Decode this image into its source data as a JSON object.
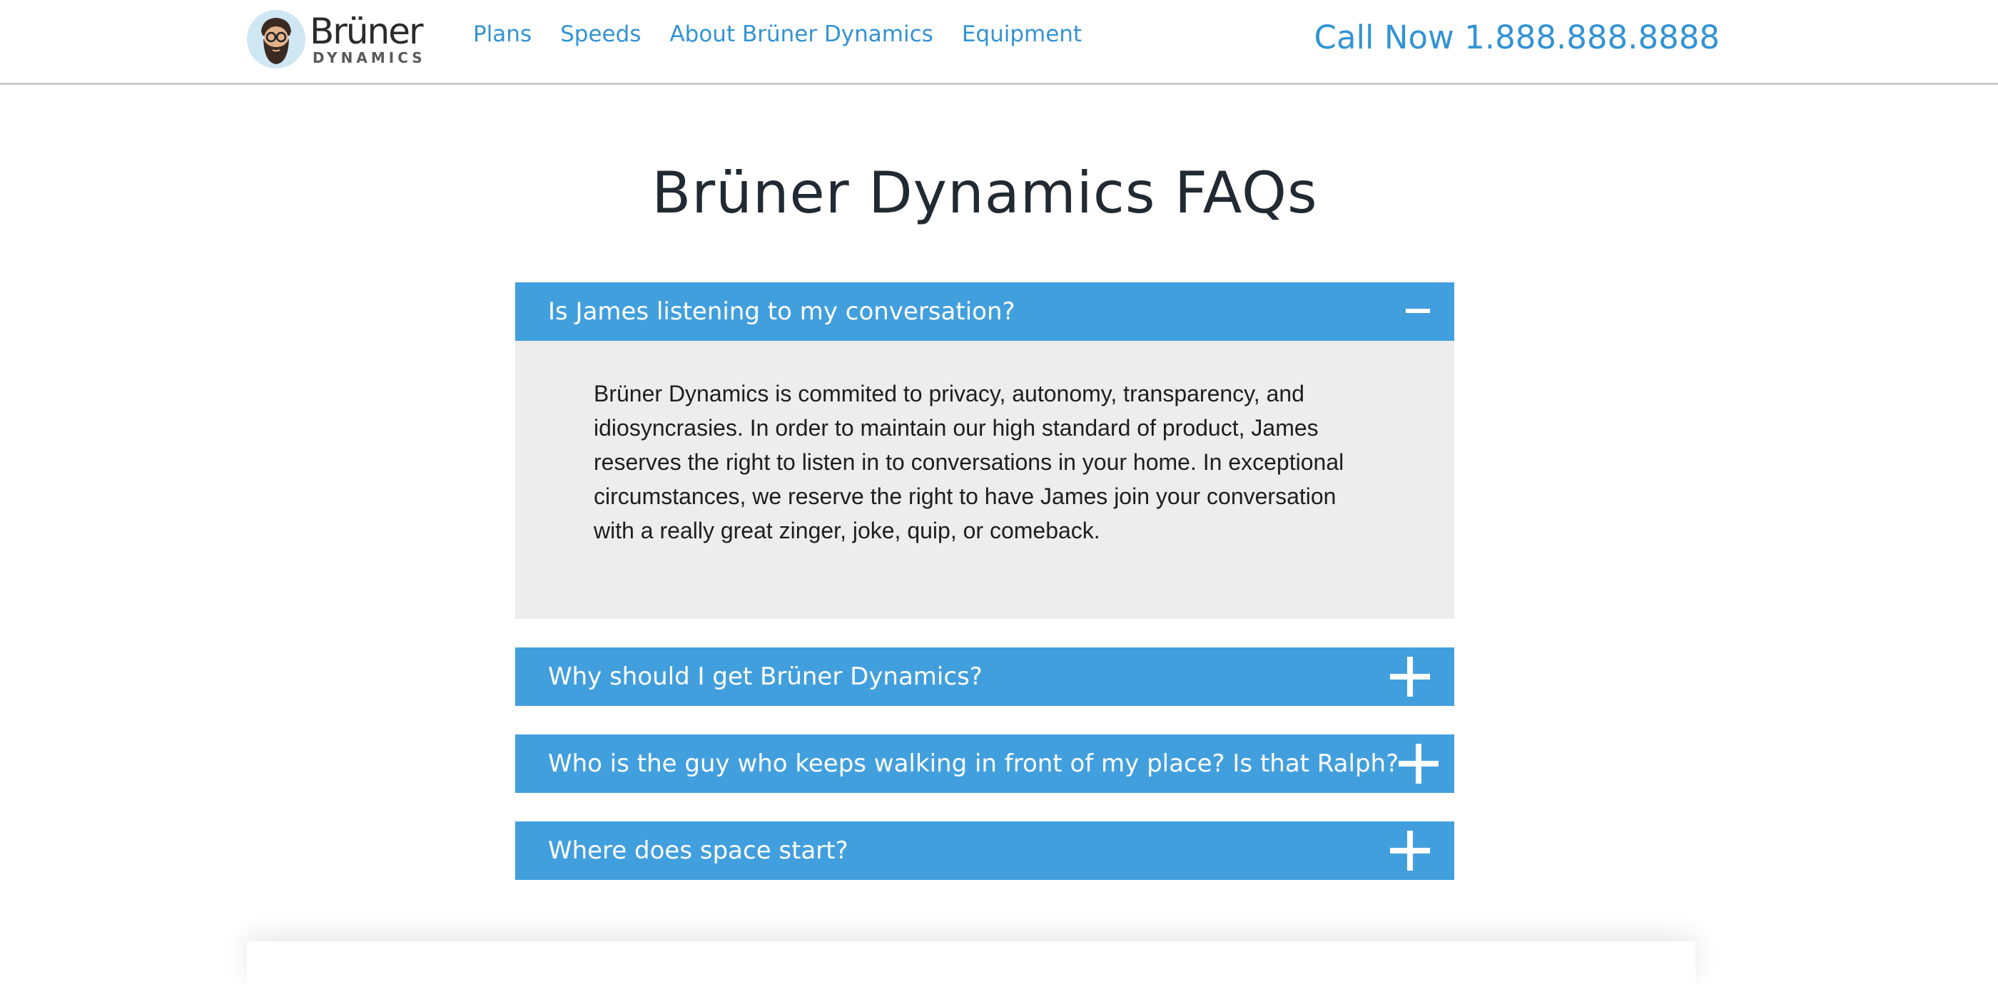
{
  "brand": {
    "name": "Brüner",
    "subtitle": "DYNAMICS",
    "logo_icon": "bearded-man-avatar-icon"
  },
  "nav": {
    "items": [
      {
        "label": "Plans"
      },
      {
        "label": "Speeds"
      },
      {
        "label": "About Brüner Dynamics"
      },
      {
        "label": "Equipment"
      }
    ],
    "call_now": "Call Now 1.888.888.8888"
  },
  "page": {
    "title": "Brüner Dynamics FAQs"
  },
  "faqs": [
    {
      "question": "Is James listening to my conversation?",
      "expanded": true,
      "icon": "minus-icon",
      "answer": "Brüner Dynamics is commited to privacy, autonomy, transparency, and idiosyncrasies. In order to maintain our high standard of product, James reserves the right to listen in to conversations in your home. In exceptional circumstances, we reserve the right to have James join your conversation with a really great zinger, joke, quip, or comeback."
    },
    {
      "question": "Why should I get Brüner Dynamics?",
      "expanded": false,
      "icon": "plus-icon"
    },
    {
      "question": "Who is the guy who keeps walking in front of my place? Is that Ralph?",
      "expanded": false,
      "icon": "plus-icon"
    },
    {
      "question": "Where does space start?",
      "expanded": false,
      "icon": "plus-icon"
    }
  ],
  "colors": {
    "accent": "#429fdd",
    "link": "#3393d4",
    "answer_bg": "#ededed",
    "title": "#212a33"
  }
}
